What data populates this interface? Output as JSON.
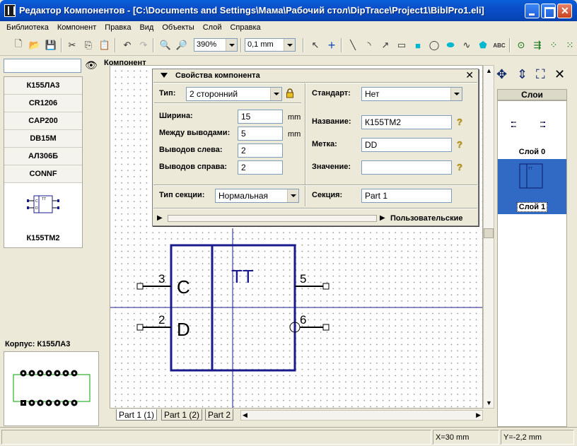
{
  "window": {
    "title": "Редактор Компонентов - [C:\\Documents and Settings\\Мама\\Рабочий стол\\DipTrace\\Project1\\BiblPro1.eli]"
  },
  "menu": [
    "Библиотека",
    "Компонент",
    "Правка",
    "Вид",
    "Объекты",
    "Слой",
    "Справка"
  ],
  "toolbar": {
    "zoom": "390%",
    "grid": "0,1 mm",
    "icons": [
      "new-icon",
      "open-icon",
      "save-icon",
      "cut-icon",
      "copy-icon",
      "paste-icon",
      "undo-icon",
      "redo-icon",
      "zoom-in-icon",
      "zoom-out-icon",
      "pointer-icon",
      "pin-icon",
      "line-icon",
      "arc-icon",
      "arrow-icon",
      "rectangle-icon",
      "filled-rectangle-icon",
      "ellipse-icon",
      "filled-ellipse-icon",
      "polyline-icon",
      "polygon-icon",
      "text-icon",
      "target-icon",
      "route-icon",
      "grid-icon",
      "points-icon"
    ],
    "text_tool": "ABC"
  },
  "left": {
    "search_value": "",
    "components": [
      "К155ЛА3",
      "CR1206",
      "CAP200",
      "DB15M",
      "АЛ306Б",
      "CONNF"
    ],
    "selected_component": "К155ТМ2",
    "preview_pins": {
      "c": "C",
      "d": "D",
      "tt": "TT"
    },
    "package_label": "Корпус:  К155ЛА3"
  },
  "canvas": {
    "section_label": "Компонент",
    "pins": [
      {
        "number": "3",
        "letter": "C"
      },
      {
        "number": "2",
        "letter": "D"
      },
      {
        "number": "5"
      },
      {
        "number": "6"
      }
    ],
    "center_text": "TT",
    "tabs": [
      "Part 1 (1)",
      "Part 1 (2)",
      "Part 2"
    ]
  },
  "properties": {
    "title": "Свойства компонента",
    "type_label": "Тип:",
    "type_value": "2 сторонний",
    "standard_label": "Стандарт:",
    "standard_value": "Нет",
    "width_label": "Ширина:",
    "width_value": "15",
    "spacing_label": "Между выводами:",
    "spacing_value": "5",
    "unit": "mm",
    "left_pins_label": "Выводов слева:",
    "left_pins_value": "2",
    "right_pins_label": "Выводов справа:",
    "right_pins_value": "2",
    "name_label": "Название:",
    "name_value": "К155ТМ2",
    "ref_label": "Метка:",
    "ref_value": "DD",
    "value_label": "Значение:",
    "value_value": "",
    "section_type_label": "Тип секции:",
    "section_type_value": "Нормальная",
    "section_label": "Секция:",
    "section_value": "Part 1",
    "custom_label": "Пользовательские"
  },
  "layers": {
    "title": "Слои",
    "items": [
      "Слой 0",
      "Слой 1"
    ]
  },
  "status": {
    "x": "X=30 mm",
    "y": "Y=-2,2 mm"
  },
  "colors": {
    "titlebar": "#0a4ec8",
    "component": "#1a1a8c",
    "selection": "#316ac5"
  }
}
